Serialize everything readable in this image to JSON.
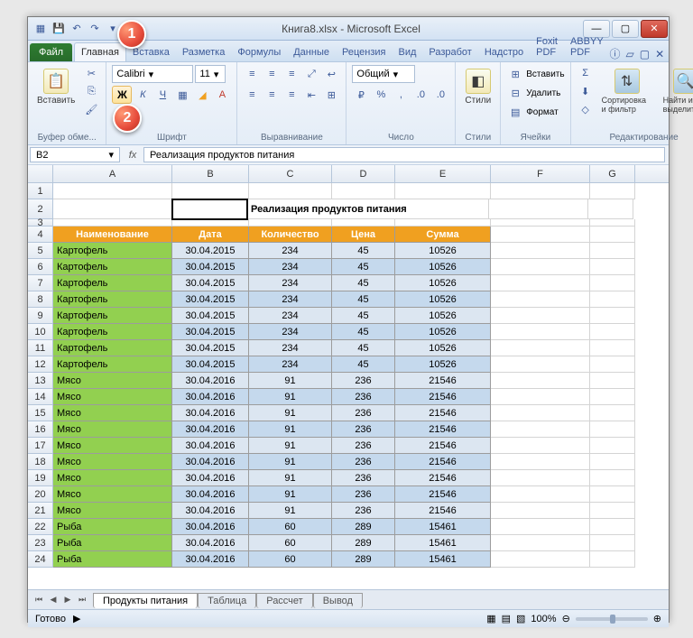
{
  "title": "Книга8.xlsx - Microsoft Excel",
  "tabs": {
    "file": "Файл",
    "items": [
      "Главная",
      "Вставка",
      "Разметка",
      "Формулы",
      "Данные",
      "Рецензия",
      "Вид",
      "Разработ",
      "Надстро",
      "Foxit PDF",
      "ABBYY PDF"
    ],
    "active": "Главная"
  },
  "ribbon": {
    "clipboard": {
      "paste": "Вставить",
      "group": "Буфер обме..."
    },
    "font": {
      "name": "Calibri",
      "size": "11",
      "group": "Шрифт",
      "bold": "Ж",
      "italic": "К",
      "underline": "Ч"
    },
    "align": {
      "group": "Выравнивание"
    },
    "number": {
      "format": "Общий",
      "group": "Число"
    },
    "styles": {
      "btn": "Стили",
      "group": "Стили"
    },
    "cells": {
      "insert": "Вставить",
      "delete": "Удалить",
      "format": "Формат",
      "group": "Ячейки"
    },
    "editing": {
      "sort": "Сортировка и фильтр",
      "find": "Найти и выделить",
      "group": "Редактирование"
    }
  },
  "namebox": "B2",
  "formula": "Реализация продуктов питания",
  "columns": [
    "A",
    "B",
    "C",
    "D",
    "E",
    "F",
    "G"
  ],
  "merged_title": "Реализация продуктов питания",
  "headers": [
    "Наименование",
    "Дата",
    "Количество",
    "Цена",
    "Сумма"
  ],
  "table_rows": [
    {
      "r": 5,
      "name": "Картофель",
      "date": "30.04.2015",
      "qty": "234",
      "price": "45",
      "sum": "10526"
    },
    {
      "r": 6,
      "name": "Картофель",
      "date": "30.04.2015",
      "qty": "234",
      "price": "45",
      "sum": "10526"
    },
    {
      "r": 7,
      "name": "Картофель",
      "date": "30.04.2015",
      "qty": "234",
      "price": "45",
      "sum": "10526"
    },
    {
      "r": 8,
      "name": "Картофель",
      "date": "30.04.2015",
      "qty": "234",
      "price": "45",
      "sum": "10526"
    },
    {
      "r": 9,
      "name": "Картофель",
      "date": "30.04.2015",
      "qty": "234",
      "price": "45",
      "sum": "10526"
    },
    {
      "r": 10,
      "name": "Картофель",
      "date": "30.04.2015",
      "qty": "234",
      "price": "45",
      "sum": "10526"
    },
    {
      "r": 11,
      "name": "Картофель",
      "date": "30.04.2015",
      "qty": "234",
      "price": "45",
      "sum": "10526"
    },
    {
      "r": 12,
      "name": "Картофель",
      "date": "30.04.2015",
      "qty": "234",
      "price": "45",
      "sum": "10526"
    },
    {
      "r": 13,
      "name": "Мясо",
      "date": "30.04.2016",
      "qty": "91",
      "price": "236",
      "sum": "21546"
    },
    {
      "r": 14,
      "name": "Мясо",
      "date": "30.04.2016",
      "qty": "91",
      "price": "236",
      "sum": "21546"
    },
    {
      "r": 15,
      "name": "Мясо",
      "date": "30.04.2016",
      "qty": "91",
      "price": "236",
      "sum": "21546"
    },
    {
      "r": 16,
      "name": "Мясо",
      "date": "30.04.2016",
      "qty": "91",
      "price": "236",
      "sum": "21546"
    },
    {
      "r": 17,
      "name": "Мясо",
      "date": "30.04.2016",
      "qty": "91",
      "price": "236",
      "sum": "21546"
    },
    {
      "r": 18,
      "name": "Мясо",
      "date": "30.04.2016",
      "qty": "91",
      "price": "236",
      "sum": "21546"
    },
    {
      "r": 19,
      "name": "Мясо",
      "date": "30.04.2016",
      "qty": "91",
      "price": "236",
      "sum": "21546"
    },
    {
      "r": 20,
      "name": "Мясо",
      "date": "30.04.2016",
      "qty": "91",
      "price": "236",
      "sum": "21546"
    },
    {
      "r": 21,
      "name": "Мясо",
      "date": "30.04.2016",
      "qty": "91",
      "price": "236",
      "sum": "21546"
    },
    {
      "r": 22,
      "name": "Рыба",
      "date": "30.04.2016",
      "qty": "60",
      "price": "289",
      "sum": "15461"
    },
    {
      "r": 23,
      "name": "Рыба",
      "date": "30.04.2016",
      "qty": "60",
      "price": "289",
      "sum": "15461"
    },
    {
      "r": 24,
      "name": "Рыба",
      "date": "30.04.2016",
      "qty": "60",
      "price": "289",
      "sum": "15461"
    }
  ],
  "sheets": [
    "Продукты питания",
    "Таблица",
    "Рассчет",
    "Вывод"
  ],
  "active_sheet": "Продукты питания",
  "status": {
    "ready": "Готово",
    "zoom": "100%"
  },
  "callouts": {
    "c1": "1",
    "c2": "2"
  }
}
